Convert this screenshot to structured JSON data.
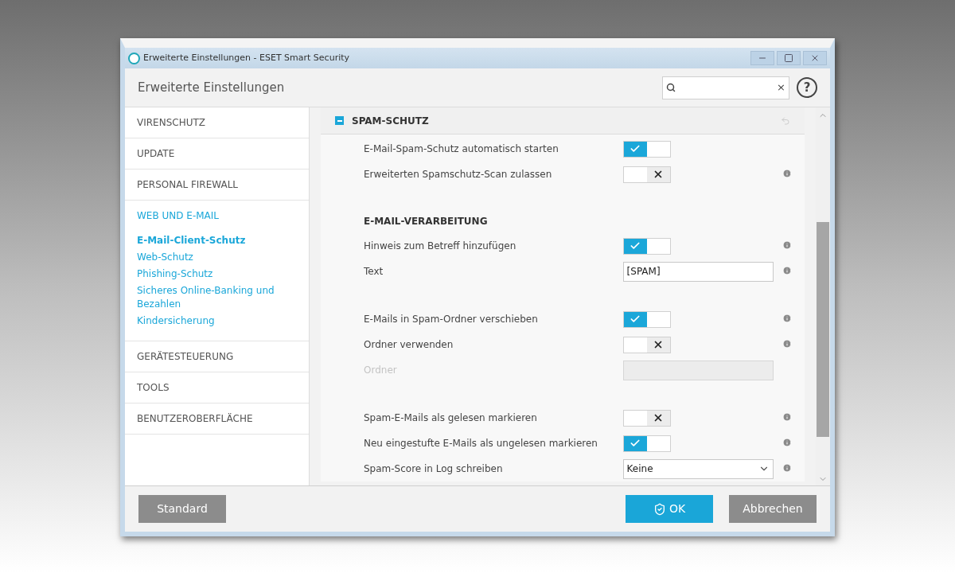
{
  "window": {
    "title": "Erweiterte Einstellungen - ESET Smart Security"
  },
  "header": {
    "title": "Erweiterte Einstellungen",
    "search": {
      "clear": "×"
    },
    "help": "?"
  },
  "sidebar": {
    "items": [
      {
        "label": "VIRENSCHUTZ",
        "expanded": false
      },
      {
        "label": "UPDATE",
        "expanded": false
      },
      {
        "label": "PERSONAL FIREWALL",
        "expanded": false
      },
      {
        "label": "WEB UND E-MAIL",
        "expanded": true,
        "children": [
          {
            "label": "E-Mail-Client-Schutz",
            "selected": true
          },
          {
            "label": "Web-Schutz",
            "selected": false
          },
          {
            "label": "Phishing-Schutz",
            "selected": false
          },
          {
            "label": "Sicheres Online-Banking und Bezahlen",
            "selected": false
          },
          {
            "label": "Kindersicherung",
            "selected": false
          }
        ]
      },
      {
        "label": "GERÄTESTEUERUNG",
        "expanded": false
      },
      {
        "label": "TOOLS",
        "expanded": false
      },
      {
        "label": "BENUTZEROBERFLÄCHE",
        "expanded": false
      }
    ]
  },
  "section": {
    "title": "SPAM-SCHUTZ",
    "expanded": true,
    "groups": [
      {
        "rows": [
          {
            "kind": "toggle",
            "label": "E-Mail-Spam-Schutz automatisch starten",
            "on": true,
            "info": false
          },
          {
            "kind": "toggle",
            "label": "Erweiterten Spamschutz-Scan zulassen",
            "on": false,
            "info": true
          }
        ]
      },
      {
        "heading": "E-MAIL-VERARBEITUNG",
        "rows": [
          {
            "kind": "toggle",
            "label": "Hinweis zum Betreff hinzufügen",
            "on": true,
            "info": true
          },
          {
            "kind": "text",
            "label": "Text",
            "value": "[SPAM]",
            "disabled": false,
            "info": true
          }
        ]
      },
      {
        "rows": [
          {
            "kind": "toggle",
            "label": "E-Mails in Spam-Ordner verschieben",
            "on": true,
            "info": true
          },
          {
            "kind": "toggle",
            "label": "Ordner verwenden",
            "on": false,
            "info": true
          },
          {
            "kind": "text",
            "label": "Ordner",
            "disabled": true,
            "info": false
          }
        ]
      },
      {
        "rows": [
          {
            "kind": "toggle",
            "label": "Spam-E-Mails als gelesen markieren",
            "on": false,
            "info": true
          },
          {
            "kind": "toggle",
            "label": "Neu eingestufte E-Mails als ungelesen markieren",
            "on": true,
            "info": true
          },
          {
            "kind": "select",
            "label": "Spam-Score in Log schreiben",
            "value": "Keine",
            "info": true
          }
        ]
      }
    ]
  },
  "footer": {
    "buttons": [
      {
        "label": "Standard",
        "kind": "default"
      },
      {
        "label": "OK",
        "kind": "primary"
      },
      {
        "label": "Abbrechen",
        "kind": "default"
      }
    ]
  }
}
